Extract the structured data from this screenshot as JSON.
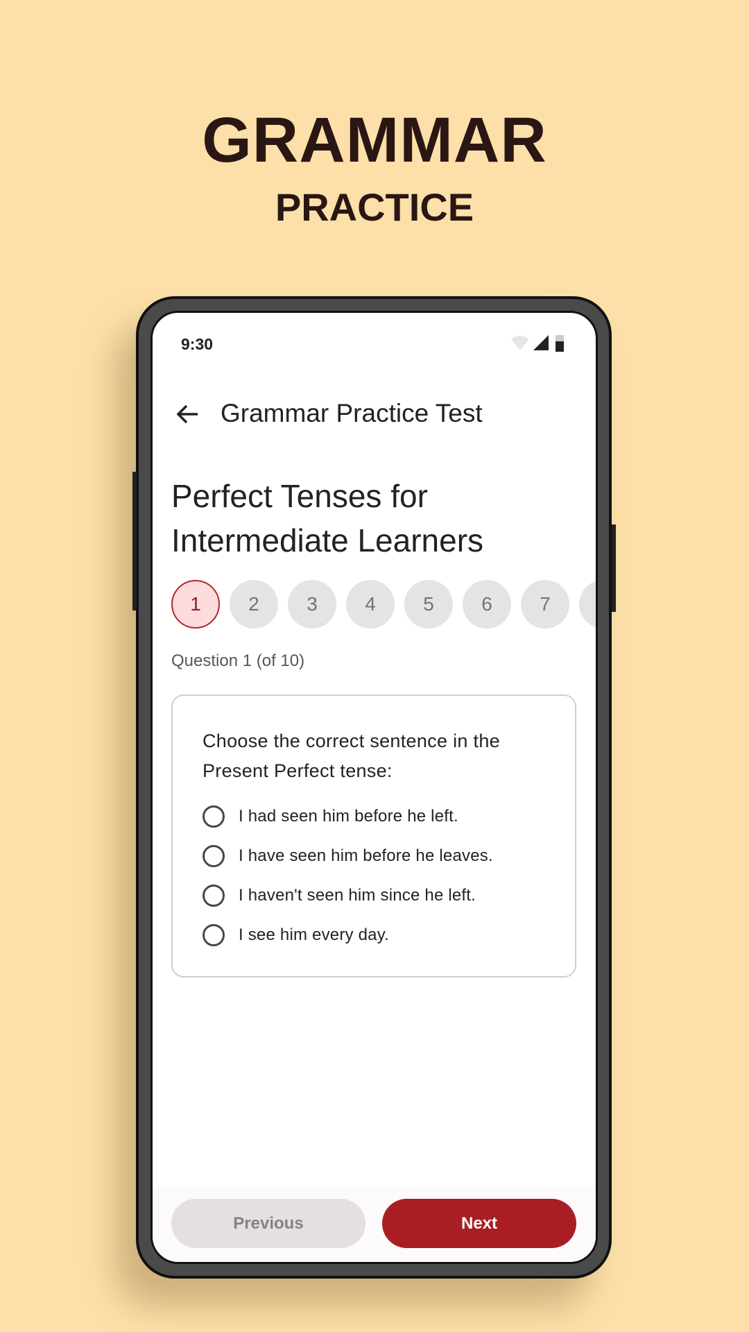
{
  "promo": {
    "title": "GRAMMAR",
    "subtitle": "PRACTICE"
  },
  "status_bar": {
    "time": "9:30"
  },
  "app_bar": {
    "title": "Grammar Practice Test"
  },
  "heading": {
    "line1": "Perfect Tenses for",
    "line2": "Intermediate Learners"
  },
  "question_nav": {
    "items": [
      "1",
      "2",
      "3",
      "4",
      "5",
      "6",
      "7"
    ],
    "active": "1"
  },
  "question_counter": "Question 1 (of 10)",
  "question": {
    "text": "Choose the correct sentence in the Present Perfect tense:",
    "options": [
      "I had seen him before he left.",
      "I have seen him before he leaves.",
      "I haven't seen him since he left.",
      "I see him every day."
    ]
  },
  "buttons": {
    "previous": "Previous",
    "next": "Next"
  },
  "colors": {
    "background": "#fde0a9",
    "accent": "#a91e22"
  }
}
